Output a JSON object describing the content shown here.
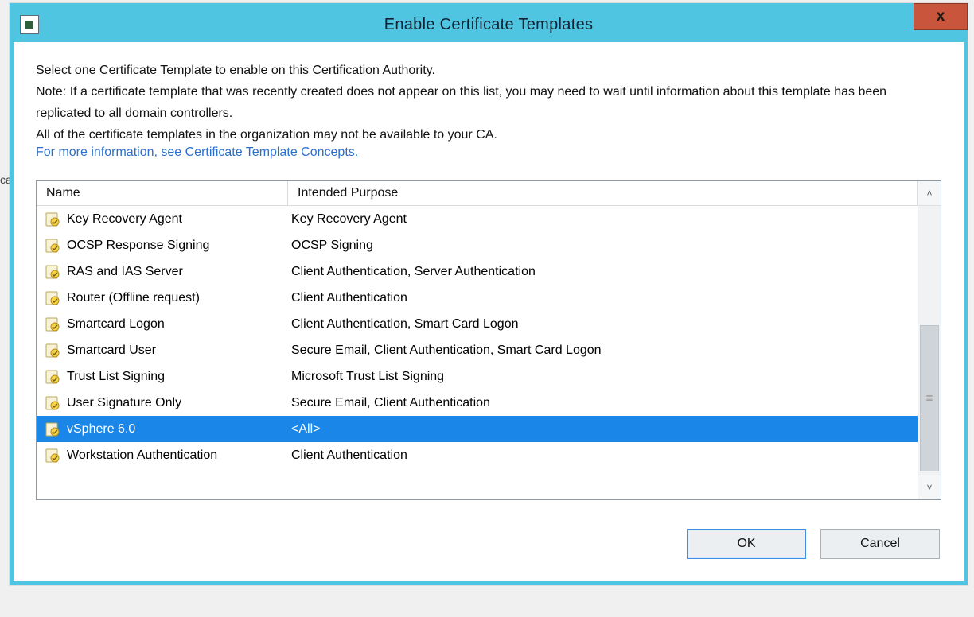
{
  "window": {
    "title": "Enable Certificate Templates",
    "close_label": "x"
  },
  "intro": {
    "line1": "Select one Certificate Template to enable on this Certification Authority.",
    "line2": "Note: If a certificate template that was recently created does not appear on this list, you may need to wait until information about this template has been replicated to all domain controllers.",
    "line3": "All of the certificate templates in the organization may not be available to your CA."
  },
  "info": {
    "prefix": "For more information, see ",
    "link_label": "Certificate Template Concepts."
  },
  "columns": {
    "name": "Name",
    "purpose": "Intended Purpose"
  },
  "rows": [
    {
      "name": "Key Recovery Agent",
      "purpose": "Key Recovery Agent",
      "selected": false
    },
    {
      "name": "OCSP Response Signing",
      "purpose": "OCSP Signing",
      "selected": false
    },
    {
      "name": "RAS and IAS Server",
      "purpose": "Client Authentication, Server Authentication",
      "selected": false
    },
    {
      "name": "Router (Offline request)",
      "purpose": "Client Authentication",
      "selected": false
    },
    {
      "name": "Smartcard Logon",
      "purpose": "Client Authentication, Smart Card Logon",
      "selected": false
    },
    {
      "name": "Smartcard User",
      "purpose": "Secure Email, Client Authentication, Smart Card Logon",
      "selected": false
    },
    {
      "name": "Trust List Signing",
      "purpose": "Microsoft Trust List Signing",
      "selected": false
    },
    {
      "name": "User Signature Only",
      "purpose": "Secure Email, Client Authentication",
      "selected": false
    },
    {
      "name": "vSphere 6.0",
      "purpose": "<All>",
      "selected": true
    },
    {
      "name": "Workstation Authentication",
      "purpose": "Client Authentication",
      "selected": false
    }
  ],
  "buttons": {
    "ok": "OK",
    "cancel": "Cancel"
  },
  "background_hint": "ca",
  "colors": {
    "chrome": "#4fc5e2",
    "selection": "#1a87e8",
    "link": "#2a6fcd",
    "close": "#c9553c"
  }
}
